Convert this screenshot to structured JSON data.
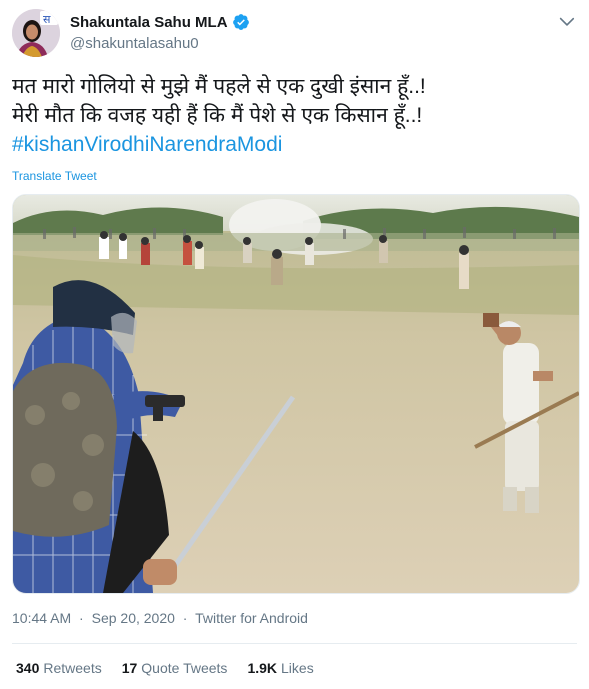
{
  "user": {
    "display_name": "Shakuntala Sahu MLA",
    "handle": "@shakuntalasahu0",
    "avatar_badge_text": "स",
    "verified_icon": "verified-badge-icon",
    "menu_icon": "chevron-down-icon"
  },
  "tweet": {
    "lines": [
      "मत मारो गोलियो से मुझे मैं पहले से एक दुखी इंसान हूँ..!",
      "मेरी मौत कि वजह यही हैं कि मैं पेशे से एक किसान हूँ..!"
    ],
    "hashtag": "#kishanVirodhiNarendraModi",
    "translate_label": "Translate Tweet"
  },
  "meta": {
    "time": "10:44 AM",
    "separator": "·",
    "date": "Sep 20, 2020",
    "source": "Twitter for Android"
  },
  "stats": {
    "retweets_count": "340",
    "retweets_label": "Retweets",
    "quotes_count": "17",
    "quotes_label": "Quote Tweets",
    "likes_count": "1.9K",
    "likes_label": "Likes"
  },
  "colors": {
    "link": "#1b95e0",
    "secondary_text": "#657786",
    "primary_text": "#14171a"
  }
}
